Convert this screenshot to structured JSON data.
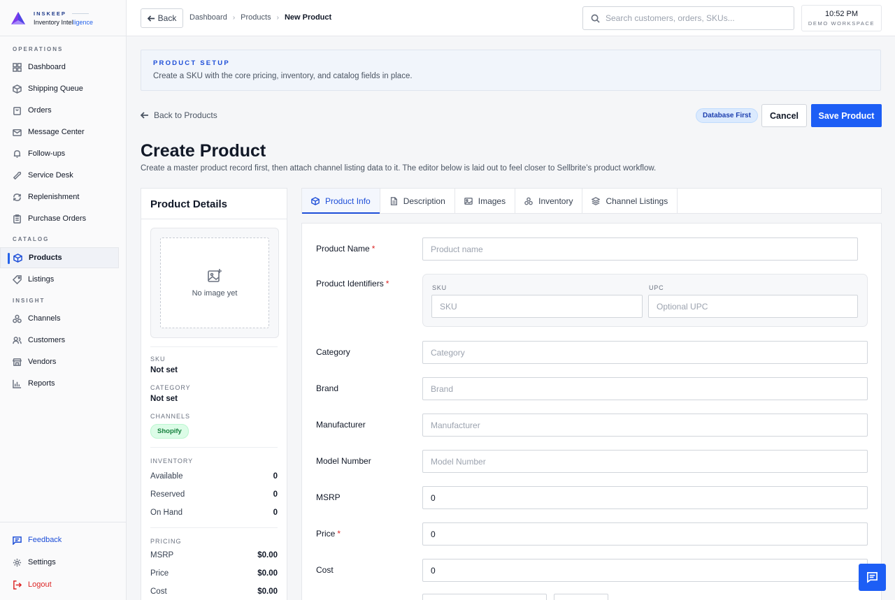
{
  "brand": {
    "name": "INSKEEP",
    "tagline_a": "Inventory Intel",
    "tagline_b": "ligence"
  },
  "sidebar": {
    "sections": [
      {
        "title": "OPERATIONS",
        "items": [
          "Dashboard",
          "Shipping Queue",
          "Orders",
          "Message Center",
          "Follow-ups",
          "Service Desk",
          "Replenishment",
          "Purchase Orders"
        ]
      },
      {
        "title": "CATALOG",
        "items": [
          "Products",
          "Listings"
        ]
      },
      {
        "title": "INSIGHT",
        "items": [
          "Channels",
          "Customers",
          "Vendors",
          "Reports"
        ]
      }
    ],
    "active": "Products",
    "bottom": {
      "feedback": "Feedback",
      "settings": "Settings",
      "logout": "Logout"
    }
  },
  "topbar": {
    "back": "Back",
    "breadcrumb": [
      "Dashboard",
      "Products",
      "New Product"
    ],
    "search_placeholder": "Search customers, orders, SKUs...",
    "time": "10:52 PM",
    "workspace": "DEMO WORKSPACE"
  },
  "banner": {
    "label": "PRODUCT SETUP",
    "description": "Create a SKU with the core pricing, inventory, and catalog fields in place."
  },
  "header": {
    "back_link": "Back to Products",
    "badge": "Database First",
    "cancel": "Cancel",
    "save": "Save Product",
    "title": "Create Product",
    "subtitle": "Create a master product record first, then attach channel listing data to it. The editor below is laid out to feel closer to Sellbrite’s product workflow."
  },
  "details": {
    "title": "Product Details",
    "no_image": "No image yet",
    "sku_label": "SKU",
    "sku_value": "Not set",
    "category_label": "CATEGORY",
    "category_value": "Not set",
    "channels_label": "CHANNELS",
    "channel": "Shopify",
    "inventory_label": "INVENTORY",
    "inventory": [
      {
        "k": "Available",
        "v": "0"
      },
      {
        "k": "Reserved",
        "v": "0"
      },
      {
        "k": "On Hand",
        "v": "0"
      }
    ],
    "pricing_label": "PRICING",
    "pricing": [
      {
        "k": "MSRP",
        "v": "$0.00"
      },
      {
        "k": "Price",
        "v": "$0.00"
      },
      {
        "k": "Cost",
        "v": "$0.00"
      }
    ]
  },
  "tabs": [
    "Product Info",
    "Description",
    "Images",
    "Inventory",
    "Channel Listings"
  ],
  "form": {
    "product_name": {
      "label": "Product Name",
      "placeholder": "Product name",
      "value": ""
    },
    "identifiers": {
      "label": "Product Identifiers",
      "sku_label": "SKU",
      "sku_placeholder": "SKU",
      "upc_label": "UPC",
      "upc_placeholder": "Optional UPC"
    },
    "category": {
      "label": "Category",
      "placeholder": "Category"
    },
    "brand": {
      "label": "Brand",
      "placeholder": "Brand"
    },
    "manufacturer": {
      "label": "Manufacturer",
      "placeholder": "Manufacturer"
    },
    "model_number": {
      "label": "Model Number",
      "placeholder": "Model Number"
    },
    "msrp": {
      "label": "MSRP",
      "value": "0"
    },
    "price": {
      "label": "Price",
      "value": "0"
    },
    "cost": {
      "label": "Cost",
      "value": "0"
    },
    "required_mark": "*"
  },
  "colors": {
    "accent": "#1d5ef5",
    "danger": "#dc2626",
    "success": "#15803d"
  }
}
